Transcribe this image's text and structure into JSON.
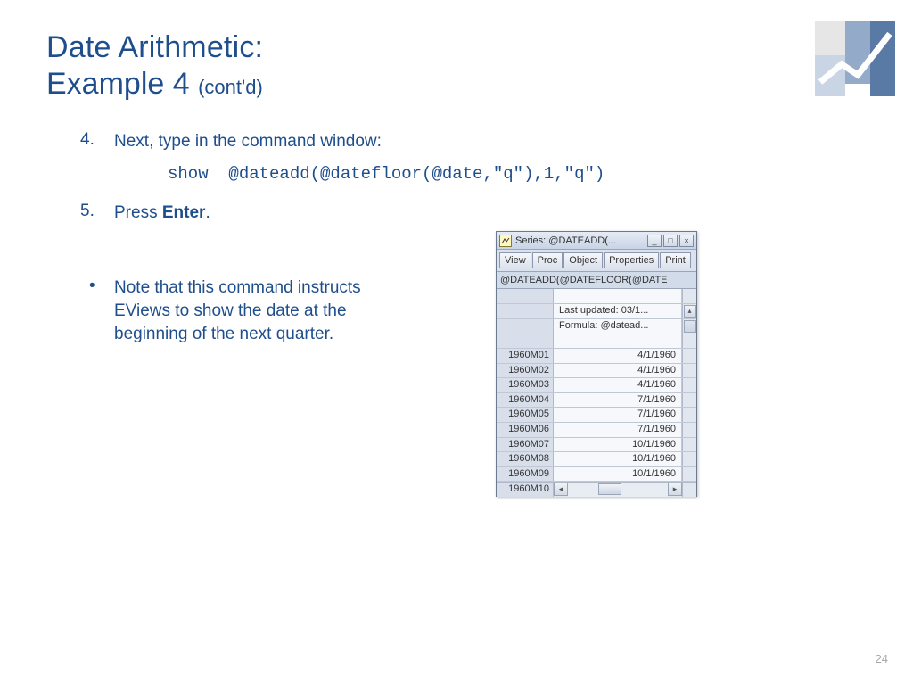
{
  "title": {
    "line1": "Date Arithmetic:",
    "line2_main": "Example 4",
    "line2_suffix": "(cont'd)"
  },
  "steps": {
    "s4": {
      "num": "4.",
      "text": "Next, type in the command window:"
    },
    "code": "show  @dateadd(@datefloor(@date,\"q\"),1,\"q\")",
    "s5": {
      "num": "5.",
      "prefix": "Press ",
      "bold": "Enter",
      "suffix": "."
    }
  },
  "bullet": {
    "text": "Note that this command instructs EViews to show the date at the beginning of the next quarter."
  },
  "eviews": {
    "title": "Series: @DATEADD(...",
    "toolbar": [
      "View",
      "Proc",
      "Object",
      "Properties",
      "Print"
    ],
    "formula": "@DATEADD(@DATEFLOOR(@DATE",
    "info": {
      "updated": "Last updated: 03/1...",
      "formulaRow": "Formula: @datead..."
    },
    "rows": [
      {
        "m": "1960M01",
        "v": "4/1/1960"
      },
      {
        "m": "1960M02",
        "v": "4/1/1960"
      },
      {
        "m": "1960M03",
        "v": "4/1/1960"
      },
      {
        "m": "1960M04",
        "v": "7/1/1960"
      },
      {
        "m": "1960M05",
        "v": "7/1/1960"
      },
      {
        "m": "1960M06",
        "v": "7/1/1960"
      },
      {
        "m": "1960M07",
        "v": "10/1/1960"
      },
      {
        "m": "1960M08",
        "v": "10/1/1960"
      },
      {
        "m": "1960M09",
        "v": "10/1/1960"
      },
      {
        "m": "1960M10",
        "v": ""
      }
    ]
  },
  "pageNumber": "24"
}
